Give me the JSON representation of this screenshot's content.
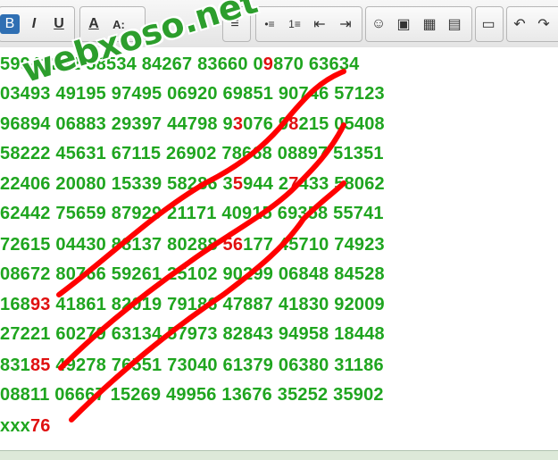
{
  "toolbar": {
    "buttons": [
      {
        "name": "bold-button",
        "label": "B"
      },
      {
        "name": "italic-button",
        "label": "I"
      },
      {
        "name": "underline-button",
        "label": "U"
      },
      {
        "name": "font-color-button",
        "label": "A"
      },
      {
        "name": "font-size-button",
        "label": "A:"
      },
      {
        "name": "align-left-button",
        "label": "≡"
      },
      {
        "name": "bullet-list-button",
        "label": "•≡"
      },
      {
        "name": "numbered-list-button",
        "label": "1≡"
      },
      {
        "name": "outdent-button",
        "label": "⇤"
      },
      {
        "name": "indent-button",
        "label": "⇥"
      },
      {
        "name": "emoji-button",
        "label": "☺"
      },
      {
        "name": "image-button",
        "label": "▣"
      },
      {
        "name": "gallery-button",
        "label": "▦"
      },
      {
        "name": "table-button",
        "label": "▤"
      },
      {
        "name": "save-button",
        "label": "▭"
      },
      {
        "name": "undo-button",
        "label": "↶"
      },
      {
        "name": "redo-button",
        "label": "↷"
      }
    ]
  },
  "watermark": "webxoso.net",
  "editor": {
    "lines": [
      {
        "pre": "5994",
        "red": "",
        "post": "1232 58534 84267 83660 0",
        "red2": "9",
        "post2": "870 63634"
      },
      {
        "pre": "03493 49195 97495 06920 69851 90746 57123",
        "red": "",
        "post": "",
        "red2": "",
        "post2": ""
      },
      {
        "pre": "96894 06883 29397 44798 9",
        "red": "3",
        "post": "076 9",
        "red2": "8",
        "post2": "215 05408"
      },
      {
        "pre": "58222 45631 67115 26902 78668 08897 51351",
        "red": "",
        "post": "",
        "red2": "",
        "post2": ""
      },
      {
        "pre": "22406 20080 15339 58286 3",
        "red": "5",
        "post": "944 2",
        "red2": "7",
        "post2": "433 58062"
      },
      {
        "pre": "62442 75659 87929 21171 40915 69358 55741",
        "red": "",
        "post": "",
        "red2": "",
        "post2": ""
      },
      {
        "pre": "72615 04430 88137 80288 ",
        "red": "56",
        "post": "177 45710 74923",
        "red2": "",
        "post2": ""
      },
      {
        "pre": "08672 80766 59261 25102 90299 06848 84528",
        "red": "",
        "post": "",
        "red2": "",
        "post2": ""
      },
      {
        "pre": "168",
        "red": "93",
        "post": " 41861 82019 79186 47887 41830 92009",
        "red2": "",
        "post2": ""
      },
      {
        "pre": "27221 60279 63134 57973 82843 94958 18448",
        "red": "",
        "post": "",
        "red2": "",
        "post2": ""
      },
      {
        "pre": "831",
        "red": "85",
        "post": " 49278 76551 73040 61379 06380 31186",
        "red2": "",
        "post2": ""
      },
      {
        "pre": "08811 06667 15269 49956 13676 35252 35902",
        "red": "",
        "post": "",
        "red2": "",
        "post2": ""
      },
      {
        "pre": "xxx",
        "red": "76",
        "post": "",
        "red2": "",
        "post2": ""
      }
    ]
  },
  "colors": {
    "number_green": "#1fa51f",
    "highlight_red": "#e01010",
    "stroke_red": "#ff0000"
  }
}
